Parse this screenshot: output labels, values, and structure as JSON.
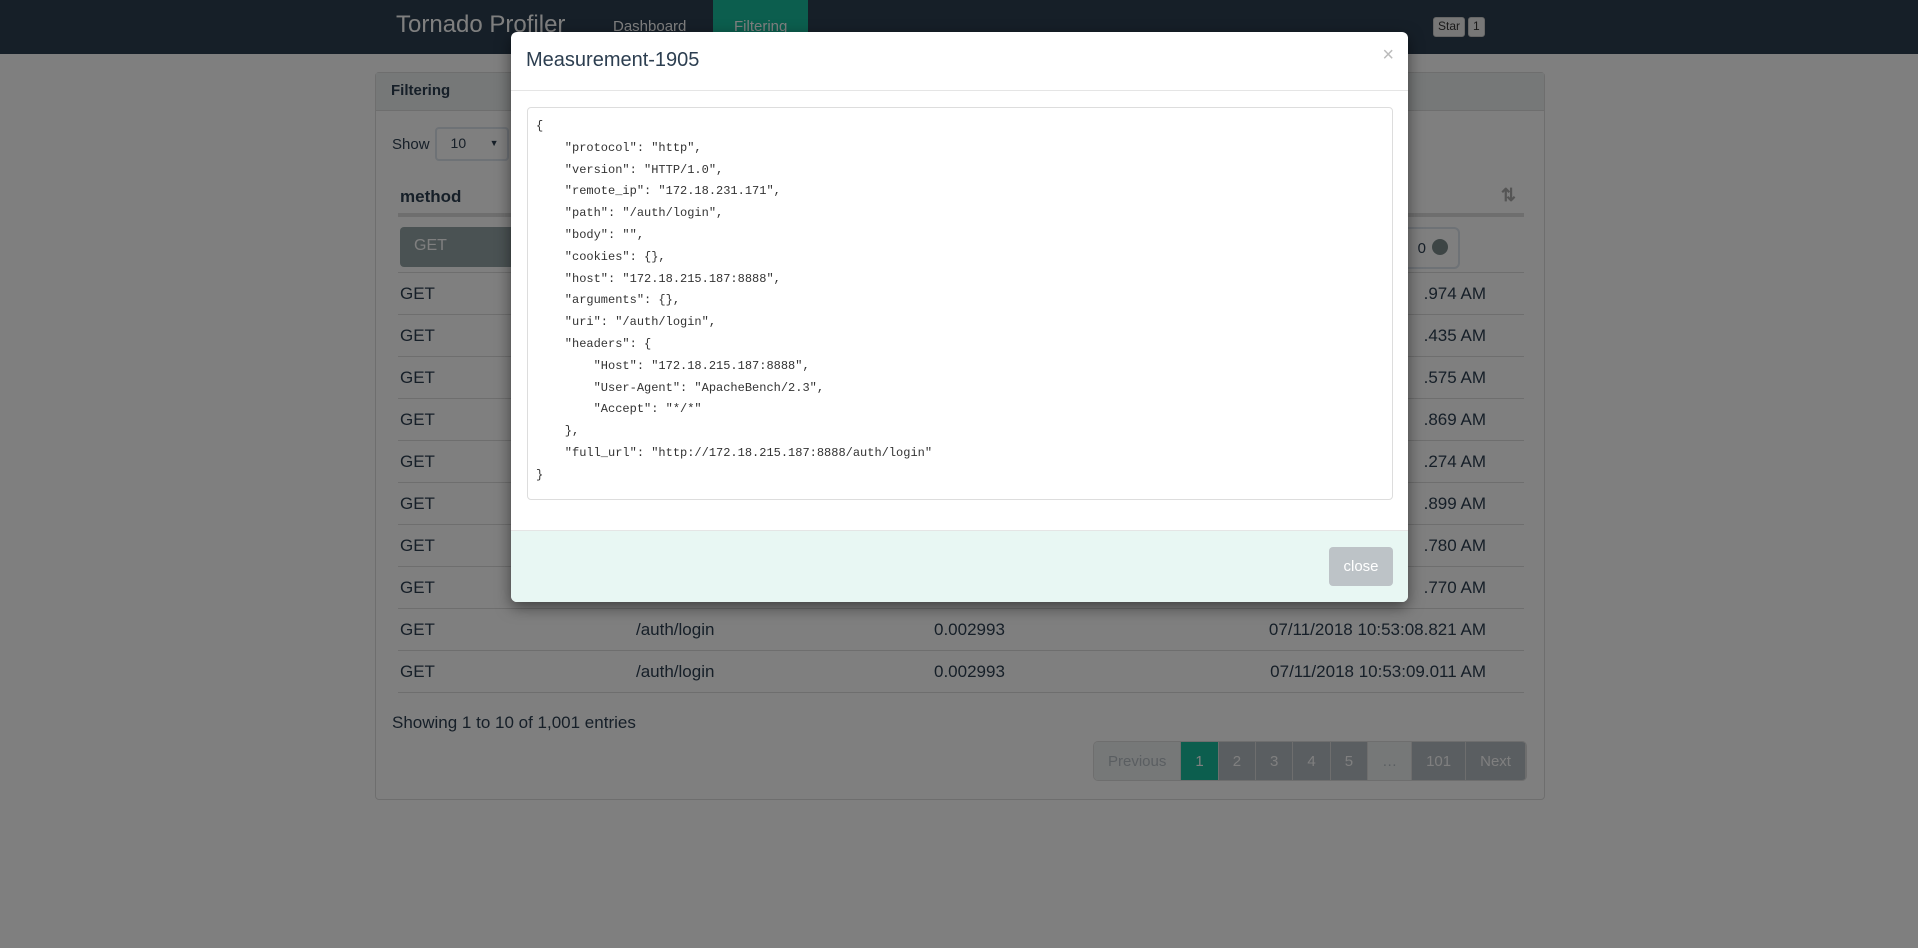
{
  "navbar": {
    "brand": "Tornado Profiler",
    "links": [
      "Dashboard",
      "Filtering"
    ],
    "active": "Filtering",
    "github_star": "Star",
    "star_count": "1"
  },
  "panel": {
    "title": "Filtering",
    "show_label": "Show",
    "page_size": "10",
    "column_method": "method",
    "filter_method": "GET",
    "filter_date_tail": "0"
  },
  "rows": [
    {
      "method": "GET",
      "path": "",
      "duration": "",
      "time": ".974 AM"
    },
    {
      "method": "GET",
      "path": "",
      "duration": "",
      "time": ".435 AM"
    },
    {
      "method": "GET",
      "path": "",
      "duration": "",
      "time": ".575 AM"
    },
    {
      "method": "GET",
      "path": "",
      "duration": "",
      "time": ".869 AM"
    },
    {
      "method": "GET",
      "path": "",
      "duration": "",
      "time": ".274 AM"
    },
    {
      "method": "GET",
      "path": "",
      "duration": "",
      "time": ".899 AM"
    },
    {
      "method": "GET",
      "path": "",
      "duration": "",
      "time": ".780 AM"
    },
    {
      "method": "GET",
      "path": "",
      "duration": "",
      "time": ".770 AM"
    },
    {
      "method": "GET",
      "path": "/auth/login",
      "duration": "0.002993",
      "time": "07/11/2018 10:53:08.821 AM"
    },
    {
      "method": "GET",
      "path": "/auth/login",
      "duration": "0.002993",
      "time": "07/11/2018 10:53:09.011 AM"
    }
  ],
  "info": "Showing 1 to 10 of 1,001 entries",
  "pagination": {
    "previous": "Previous",
    "pages": [
      "1",
      "2",
      "3",
      "4",
      "5",
      "…",
      "101"
    ],
    "next": "Next",
    "current": "1"
  },
  "modal": {
    "title": "Measurement-1905",
    "close_x": "×",
    "close_label": "close",
    "body": "{\n    \"protocol\": \"http\",\n    \"version\": \"HTTP/1.0\",\n    \"remote_ip\": \"172.18.231.171\",\n    \"path\": \"/auth/login\",\n    \"body\": \"\",\n    \"cookies\": {},\n    \"host\": \"172.18.215.187:8888\",\n    \"arguments\": {},\n    \"uri\": \"/auth/login\",\n    \"headers\": {\n        \"Host\": \"172.18.215.187:8888\",\n        \"User-Agent\": \"ApacheBench/2.3\",\n        \"Accept\": \"*/*\"\n    },\n    \"full_url\": \"http://172.18.215.187:8888/auth/login\"\n}"
  },
  "colors": {
    "navbar": "#2c3e50",
    "accent": "#18bc9c",
    "modal_footer": "#e8f7f3"
  }
}
